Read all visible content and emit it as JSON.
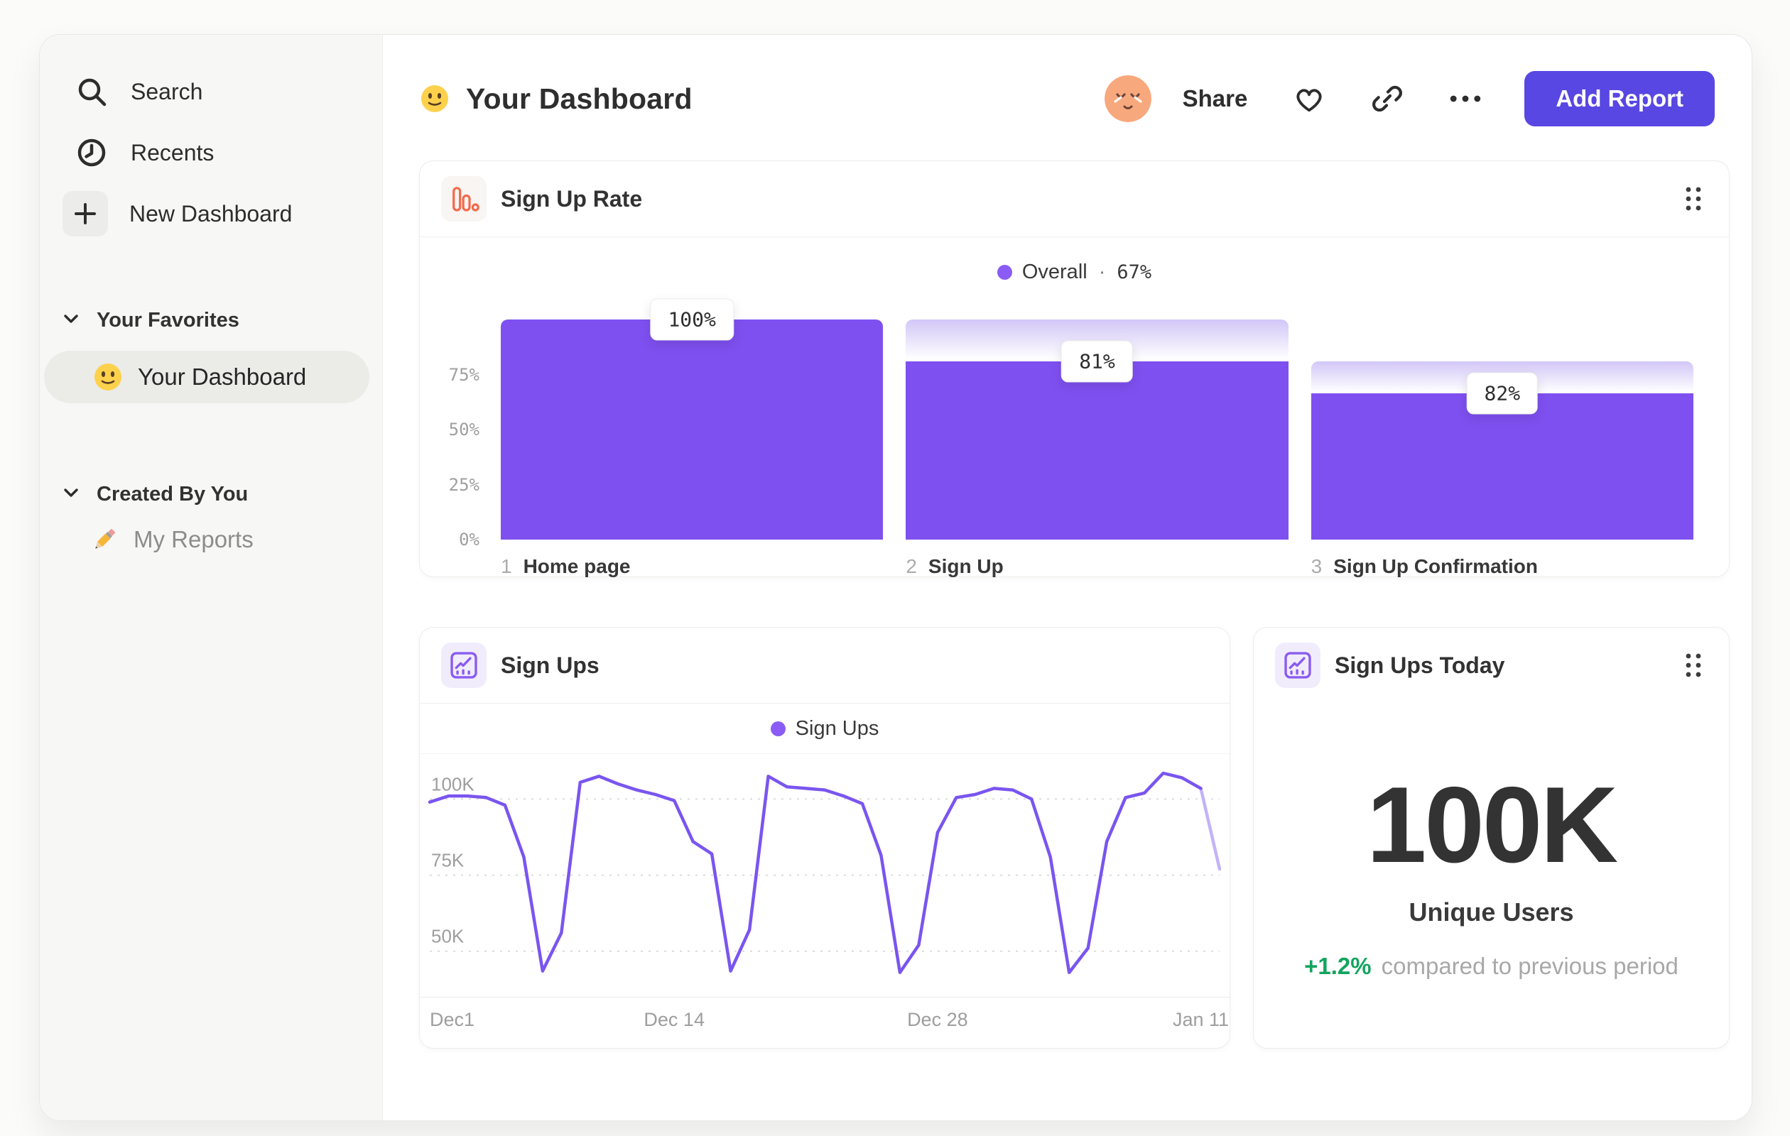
{
  "sidebar": {
    "nav": [
      {
        "label": "Search",
        "icon": "search-icon"
      },
      {
        "label": "Recents",
        "icon": "recents-icon"
      },
      {
        "label": "New Dashboard",
        "icon": "plus-icon"
      }
    ],
    "sections": [
      {
        "title": "Your Favorites",
        "items": [
          {
            "label": "Your Dashboard",
            "icon": "smiley-emoji",
            "active": true
          }
        ]
      },
      {
        "title": "Created By You",
        "items": [
          {
            "label": "My Reports",
            "icon": "pencil-emoji",
            "active": false
          }
        ]
      }
    ]
  },
  "header": {
    "title": "Your Dashboard",
    "title_emoji": "slightly-smiling-face",
    "share_label": "Share",
    "add_report_label": "Add Report",
    "accent_color": "#5847e2"
  },
  "cards": {
    "funnel": {
      "title": "Sign Up Rate",
      "legend_label": "Overall",
      "legend_separator": "·",
      "legend_value": "67%",
      "legend_dot_color": "#8a5cf5"
    },
    "line": {
      "title": "Sign Ups",
      "legend_label": "Sign Ups",
      "legend_dot_color": "#8a5cf5"
    },
    "big_number": {
      "title": "Sign Ups Today",
      "value": "100K",
      "subtitle": "Unique Users",
      "change": "+1.2%",
      "change_note": "compared to previous period",
      "change_color": "#13a45e"
    }
  },
  "chart_data": [
    {
      "type": "funnel_bar",
      "title": "Sign Up Rate",
      "overall_conversion": "67%",
      "bar_color": "#7e50f0",
      "y_ticks": [
        "75%",
        "50%",
        "25%",
        "0%"
      ],
      "steps": [
        {
          "index": "1",
          "name": "Home page",
          "label": "100%",
          "overall_pct": 100
        },
        {
          "index": "2",
          "name": "Sign Up",
          "label": "81%",
          "overall_pct": 81
        },
        {
          "index": "3",
          "name": "Sign Up Confirmation",
          "label": "82%",
          "overall_pct": 66.4
        }
      ]
    },
    {
      "type": "line",
      "title": "Sign Ups",
      "unit": "thousands",
      "line_color": "#7a55ef",
      "partial_tail_color": "#c3b3f8",
      "partial_tail_points": 1,
      "ylim": [
        35,
        112
      ],
      "y_ticks": [
        {
          "label": "100K",
          "value": 100
        },
        {
          "label": "75K",
          "value": 75
        },
        {
          "label": "50K",
          "value": 50
        }
      ],
      "x_ticks": [
        {
          "label": "Dec1",
          "index": 0
        },
        {
          "label": "Dec 14",
          "index": 13
        },
        {
          "label": "Dec 28",
          "index": 27
        },
        {
          "label": "Jan 11",
          "index": 41
        }
      ],
      "values_thousands": [
        99,
        101,
        101,
        100.5,
        98,
        81,
        43.5,
        56,
        105.5,
        107.5,
        105,
        103,
        101.5,
        99.5,
        86,
        82,
        43.5,
        57,
        107.5,
        104,
        103.5,
        103,
        101,
        98.5,
        81.5,
        43,
        52,
        89,
        100.5,
        101.5,
        103.5,
        103,
        100,
        81,
        43,
        51,
        86,
        100.5,
        102,
        108.5,
        107,
        103.5,
        77
      ]
    }
  ]
}
